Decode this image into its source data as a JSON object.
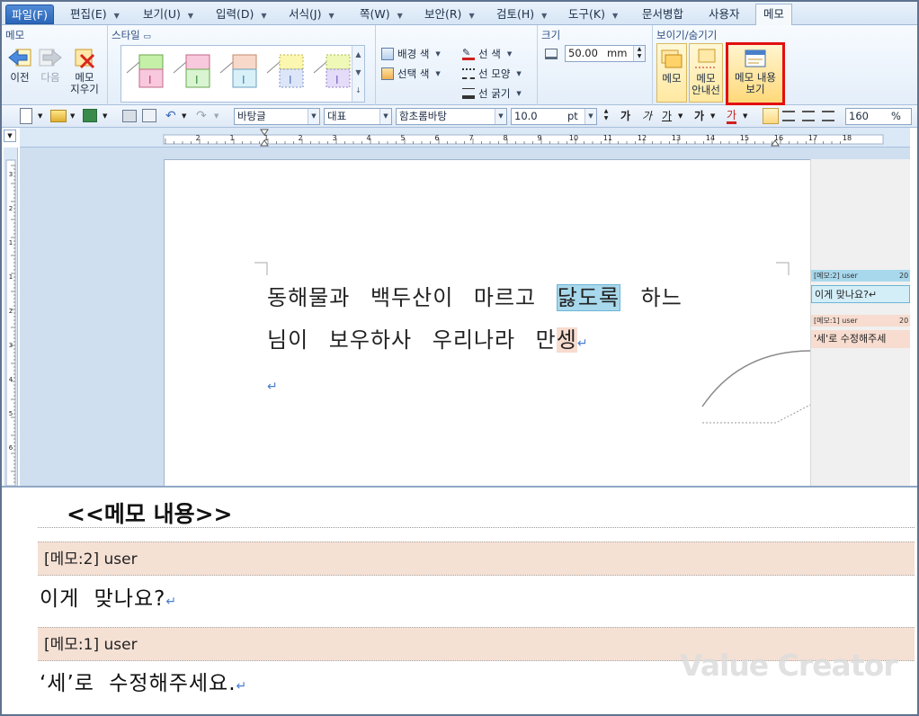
{
  "menu": {
    "tabs": [
      {
        "label": "파일(F)",
        "dropdown": false
      },
      {
        "label": "편집(E)",
        "dropdown": true
      },
      {
        "label": "보기(U)",
        "dropdown": true
      },
      {
        "label": "입력(D)",
        "dropdown": true
      },
      {
        "label": "서식(J)",
        "dropdown": true
      },
      {
        "label": "쪽(W)",
        "dropdown": true
      },
      {
        "label": "보안(R)",
        "dropdown": true
      },
      {
        "label": "검토(H)",
        "dropdown": true
      },
      {
        "label": "도구(K)",
        "dropdown": true
      },
      {
        "label": "문서병합",
        "dropdown": false
      },
      {
        "label": "사용자",
        "dropdown": false
      },
      {
        "label": "메모",
        "dropdown": false
      }
    ],
    "active_tab": "메모"
  },
  "ribbon": {
    "memo_group": {
      "title": "메모",
      "prev": "이전",
      "next": "다음",
      "delete": "메모\n지우기"
    },
    "style_group": {
      "title": "스타일"
    },
    "color_group": {
      "bg_color": "배경 색",
      "sel_color": "선택 색",
      "line_color": "선 색",
      "line_shape": "선 모양",
      "line_width": "선 굵기"
    },
    "size_group": {
      "title": "크기",
      "value": "50.00",
      "unit": "mm"
    },
    "view_group": {
      "title": "보이기/숨기기",
      "memo": "메모",
      "memo_guide": "메모\n안내선",
      "memo_content_view": "메모 내용\n보기"
    }
  },
  "toolbar": {
    "style_combo": "바탕글",
    "lang_combo": "대표",
    "font_combo": "함초롬바탕",
    "size_value": "10.0",
    "size_unit": "pt",
    "bold": "가",
    "italic": "가",
    "underline": "가",
    "strike": "가",
    "fontcolor": "가",
    "zoom_value": "160",
    "zoom_unit": "%"
  },
  "ruler": {
    "h_numbers": [
      "2",
      "1",
      "1",
      "2",
      "3",
      "4",
      "5",
      "6",
      "7",
      "8",
      "9",
      "10",
      "11",
      "12",
      "13",
      "14",
      "15",
      "16",
      "17",
      "18"
    ],
    "v_numbers": [
      "3",
      "2",
      "1",
      "1",
      "2",
      "3",
      "4",
      "5",
      "6"
    ]
  },
  "document": {
    "line1_before": "동해물과 백두산이 마르고",
    "line1_highlight": "닳도록",
    "line1_after": "하느",
    "line2_before": "님이 보우하사 우리나라 만",
    "line2_highlight": "셍",
    "para_mark": "↵"
  },
  "memo_balloons": [
    {
      "header": "[메모:2] user",
      "date": "20",
      "body": "이게 맞나요?↵"
    },
    {
      "header": "[메모:1] user",
      "date": "20",
      "body": "'세'로 수정해주세"
    }
  ],
  "memo_content": {
    "title": "<<메모 내용>>",
    "items": [
      {
        "header": "[메모:2] user",
        "body": "이게 맞나요?"
      },
      {
        "header": "[메모:1] user",
        "body": "‘세’로 수정해주세요."
      }
    ],
    "para_mark": "↵"
  },
  "watermark": "Value Creator",
  "colors": {
    "selection_outline": "#e21010",
    "memo_blue": "#a8d8ec",
    "memo_peach": "#f5e0d4",
    "menu_bg": "#d6e5f5"
  }
}
